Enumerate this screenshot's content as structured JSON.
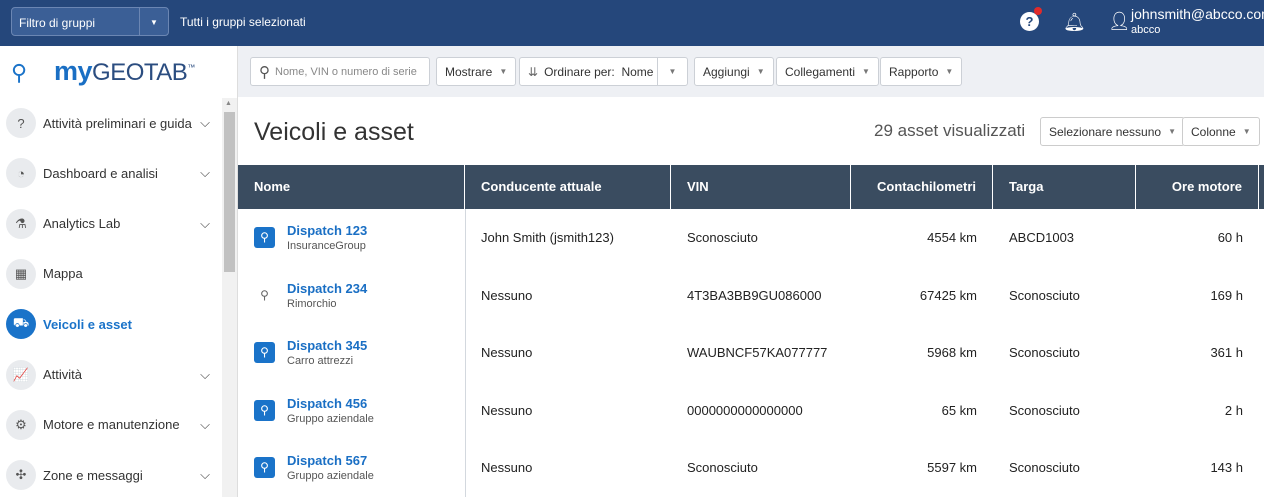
{
  "header": {
    "group_filter": "Filtro di gruppi",
    "all_groups": "Tutti i gruppi selezionati",
    "email": "johnsmith@abcco.com",
    "company": "abcco"
  },
  "logo": {
    "my": "my",
    "geotab": "GEOTAB",
    "tm": "™"
  },
  "sidebar": {
    "items": [
      {
        "label": "Attività preliminari e guida",
        "icon": "help-icon",
        "glyph": "?",
        "chevron": true
      },
      {
        "label": "Dashboard e analisi",
        "icon": "pie-chart-icon",
        "glyph": "◔",
        "chevron": true
      },
      {
        "label": "Analytics Lab",
        "icon": "flask-icon",
        "glyph": "⚗",
        "chevron": true
      },
      {
        "label": "Mappa",
        "icon": "map-icon",
        "glyph": "▦",
        "chevron": false
      },
      {
        "label": "Veicoli e asset",
        "icon": "truck-icon",
        "glyph": "⛟",
        "chevron": false,
        "active": true
      },
      {
        "label": "Attività",
        "icon": "activity-chart-icon",
        "glyph": "📈",
        "chevron": true
      },
      {
        "label": "Motore e manutenzione",
        "icon": "engine-icon",
        "glyph": "⚙",
        "chevron": true
      },
      {
        "label": "Zone e messaggi",
        "icon": "zones-icon",
        "glyph": "✣",
        "chevron": true
      }
    ]
  },
  "toolbar": {
    "search_placeholder": "Nome, VIN o numero di serie",
    "show": "Mostrare",
    "sort_label": "Ordinare per:",
    "sort_value": "Nome",
    "add": "Aggiungi",
    "links": "Collegamenti",
    "report": "Rapporto"
  },
  "page": {
    "title": "Veicoli e asset",
    "count": "29 asset visualizzati",
    "select_none": "Selezionare nessuno",
    "columns": "Colonne"
  },
  "table": {
    "headers": [
      "Nome",
      "Conducente attuale",
      "VIN",
      "Contachilometri",
      "Targa",
      "Ore motore"
    ],
    "rows": [
      {
        "name": "Dispatch 123",
        "group": "InsuranceGroup",
        "driver": "John Smith (jsmith123)",
        "vin": "Sconosciuto",
        "odometer": "4554 km",
        "plate": "ABCD1003",
        "hours": "60 h",
        "active_pin": true
      },
      {
        "name": "Dispatch 234",
        "group": "Rimorchio",
        "driver": "Nessuno",
        "vin": "4T3BA3BB9GU086000",
        "odometer": "67425 km",
        "plate": "Sconosciuto",
        "hours": "169 h",
        "active_pin": false
      },
      {
        "name": "Dispatch 345",
        "group": "Carro attrezzi",
        "driver": "Nessuno",
        "vin": "WAUBNCF57KA077777",
        "odometer": "5968 km",
        "plate": "Sconosciuto",
        "hours": "361 h",
        "active_pin": true
      },
      {
        "name": "Dispatch 456",
        "group": "Gruppo aziendale",
        "driver": "Nessuno",
        "vin": "0000000000000000",
        "odometer": "65 km",
        "plate": "Sconosciuto",
        "hours": "2 h",
        "active_pin": true
      },
      {
        "name": "Dispatch 567",
        "group": "Gruppo aziendale",
        "driver": "Nessuno",
        "vin": "Sconosciuto",
        "odometer": "5597 km",
        "plate": "Sconosciuto",
        "hours": "143 h",
        "active_pin": true
      }
    ]
  }
}
